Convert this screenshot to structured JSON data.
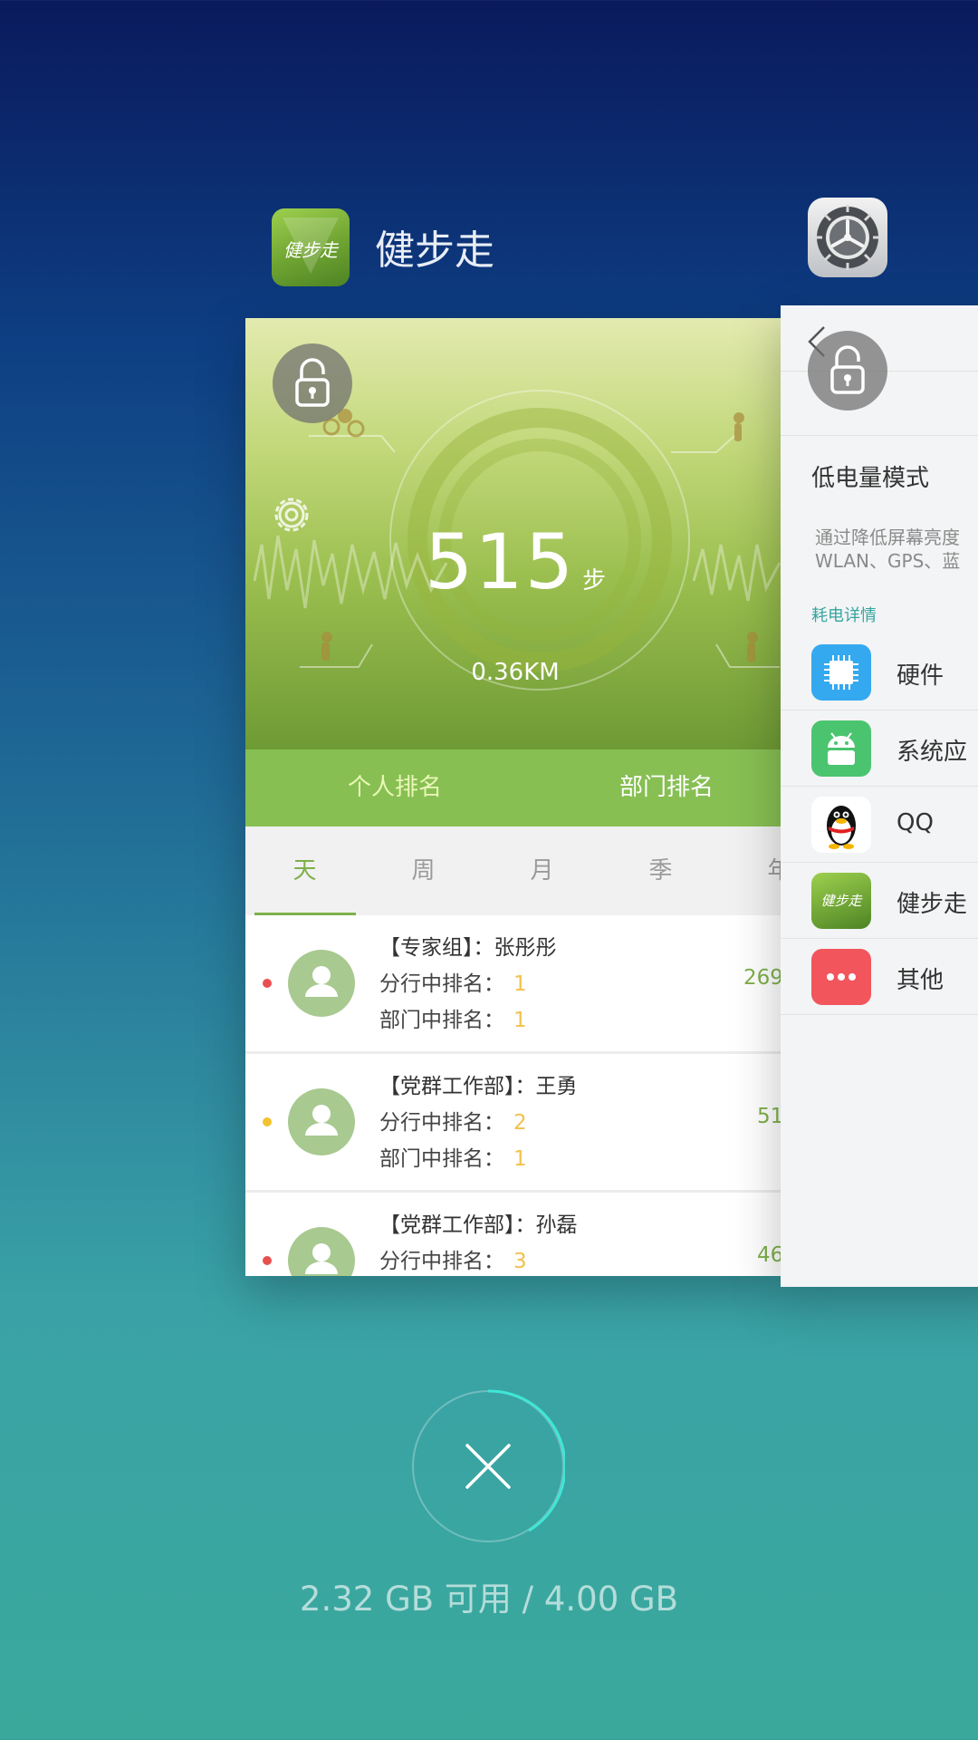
{
  "header": {
    "app_name": "健步走",
    "app_icon_text": "健步走"
  },
  "card": {
    "steps": "515",
    "steps_unit": "步",
    "distance": "0.36KM",
    "tabs": [
      "个人排名",
      "部门排名"
    ],
    "periods": [
      "天",
      "周",
      "月",
      "季",
      "年"
    ],
    "rankings": [
      {
        "name": "【专家组】：张彤彤",
        "branch_label": "分行中排名：",
        "branch_rank": "1",
        "dept_label": "部门中排名：",
        "dept_rank": "1",
        "score": "269",
        "dot_color": "#e85050"
      },
      {
        "name": "【党群工作部】：王勇",
        "branch_label": "分行中排名：",
        "branch_rank": "2",
        "dept_label": "部门中排名：",
        "dept_rank": "1",
        "score": "51",
        "dot_color": "#f2c230"
      },
      {
        "name": "【党群工作部】：孙磊",
        "branch_label": "分行中排名：",
        "branch_rank": "3",
        "score": "46",
        "dot_color": "#e85050"
      }
    ]
  },
  "settings_card": {
    "low_power_mode": "低电量模式",
    "desc_line1": "通过降低屏幕亮度",
    "desc_line2": "WLAN、GPS、蓝",
    "section_title": "耗电详情",
    "items": [
      {
        "label": "硬件",
        "icon": "chip-icon"
      },
      {
        "label": "系统应",
        "icon": "android-icon"
      },
      {
        "label": "QQ",
        "icon": "qq-penguin-icon"
      },
      {
        "label": "健步走",
        "icon": "jianbuzou-app-icon"
      },
      {
        "label": "其他",
        "icon": "more-dots-icon"
      }
    ]
  },
  "memory": "2.32 GB 可用 / 4.00 GB",
  "colors": {
    "accent_green": "#87bf53",
    "rank_yellow": "#f2c14a",
    "teal": "#35a5a0"
  }
}
